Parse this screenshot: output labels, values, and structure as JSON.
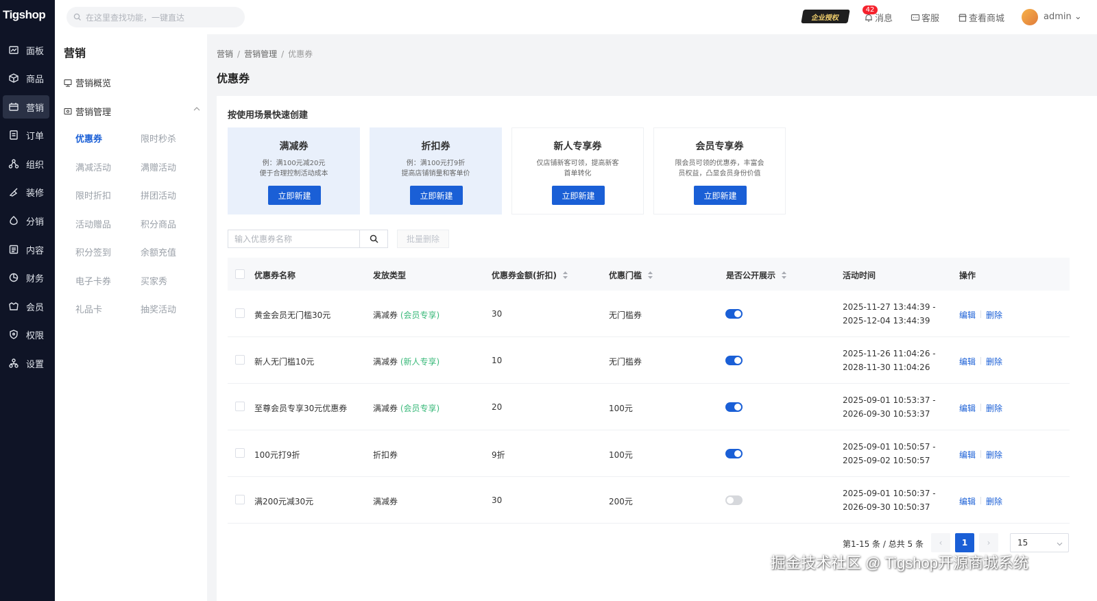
{
  "brand": {
    "logo_text": "Tigshop"
  },
  "left_nav": {
    "items": [
      {
        "label": "面板",
        "icon": "dashboard-icon"
      },
      {
        "label": "商品",
        "icon": "box-icon"
      },
      {
        "label": "营销",
        "icon": "marketing-icon",
        "active": true
      },
      {
        "label": "订单",
        "icon": "order-icon"
      },
      {
        "label": "组织",
        "icon": "org-icon"
      },
      {
        "label": "装修",
        "icon": "brush-icon"
      },
      {
        "label": "分销",
        "icon": "distribution-icon"
      },
      {
        "label": "内容",
        "icon": "content-icon"
      },
      {
        "label": "财务",
        "icon": "finance-icon"
      },
      {
        "label": "会员",
        "icon": "member-icon"
      },
      {
        "label": "权限",
        "icon": "shield-icon"
      },
      {
        "label": "设置",
        "icon": "settings-icon"
      }
    ]
  },
  "topbar": {
    "search_placeholder": "在这里查找功能，一键直达",
    "enterprise_badge": "企业授权",
    "message_count": "42",
    "messages": "消息",
    "service": "客服",
    "view_store": "查看商城",
    "user": "admin"
  },
  "sub_nav": {
    "title": "营销",
    "overview": "营销概览",
    "management": "营销管理",
    "items": [
      "优惠券",
      "限时秒杀",
      "满减活动",
      "满赠活动",
      "限时折扣",
      "拼团活动",
      "活动赠品",
      "积分商品",
      "积分签到",
      "余额充值",
      "电子卡券",
      "买家秀",
      "礼品卡",
      "抽奖活动"
    ],
    "active_item": "优惠券"
  },
  "breadcrumb": [
    "营销",
    "营销管理",
    "优惠券"
  ],
  "page_title": "优惠券",
  "quick_create": {
    "title": "按使用场景快速创建",
    "cards": [
      {
        "title": "满减券",
        "desc1": "例：满100元减20元",
        "desc2": "便于合理控制活动成本",
        "button": "立即新建"
      },
      {
        "title": "折扣券",
        "desc1": "例：满100元打9折",
        "desc2": "提高店铺销量和客单价",
        "button": "立即新建"
      },
      {
        "title": "新人专享券",
        "desc1": "仅店铺新客可领，提高新客",
        "desc2": "首单转化",
        "button": "立即新建"
      },
      {
        "title": "会员专享券",
        "desc1": "限会员可领的优惠券，丰富会",
        "desc2": "员权益，凸显会员身份价值",
        "button": "立即新建"
      }
    ]
  },
  "filters": {
    "name_placeholder": "输入优惠券名称",
    "batch_delete": "批量删除"
  },
  "table": {
    "columns": [
      "优惠券名称",
      "发放类型",
      "优惠券金额(折扣)",
      "优惠门槛",
      "是否公开展示",
      "活动时间",
      "操作"
    ],
    "rows": [
      {
        "name": "黄金会员无门槛30元",
        "type": "满减券",
        "tag": "(会员专享)",
        "amount": "30",
        "threshold": "无门槛券",
        "public": true,
        "start": "2025-11-27 13:44:39 -",
        "end": "2025-12-04 13:44:39"
      },
      {
        "name": "新人无门槛10元",
        "type": "满减券",
        "tag": "(新人专享)",
        "amount": "10",
        "threshold": "无门槛券",
        "public": true,
        "start": "2025-11-26 11:04:26 -",
        "end": "2028-11-30 11:04:26"
      },
      {
        "name": "至尊会员专享30元优惠券",
        "type": "满减券",
        "tag": "(会员专享)",
        "amount": "20",
        "threshold": "100元",
        "public": true,
        "start": "2025-09-01 10:53:37 -",
        "end": "2026-09-30 10:53:37"
      },
      {
        "name": "100元打9折",
        "type": "折扣券",
        "tag": "",
        "amount": "9折",
        "threshold": "100元",
        "public": true,
        "start": "2025-09-01 10:50:57 -",
        "end": "2025-09-02 10:50:57"
      },
      {
        "name": "满200元减30元",
        "type": "满减券",
        "tag": "",
        "amount": "30",
        "threshold": "200元",
        "public": false,
        "start": "2025-09-01 10:50:37 -",
        "end": "2026-09-30 10:50:37"
      }
    ],
    "edit": "编辑",
    "delete": "删除"
  },
  "pagination": {
    "summary": "第1-15 条 / 总共 5 条",
    "current_page": "1",
    "page_size": "15"
  },
  "watermark": "掘金技术社区 @ Tigshop开源商城系统",
  "colors": {
    "primary": "#1a5fd6",
    "nav_bg": "#0f1426",
    "tag_green": "#3ab97a"
  }
}
